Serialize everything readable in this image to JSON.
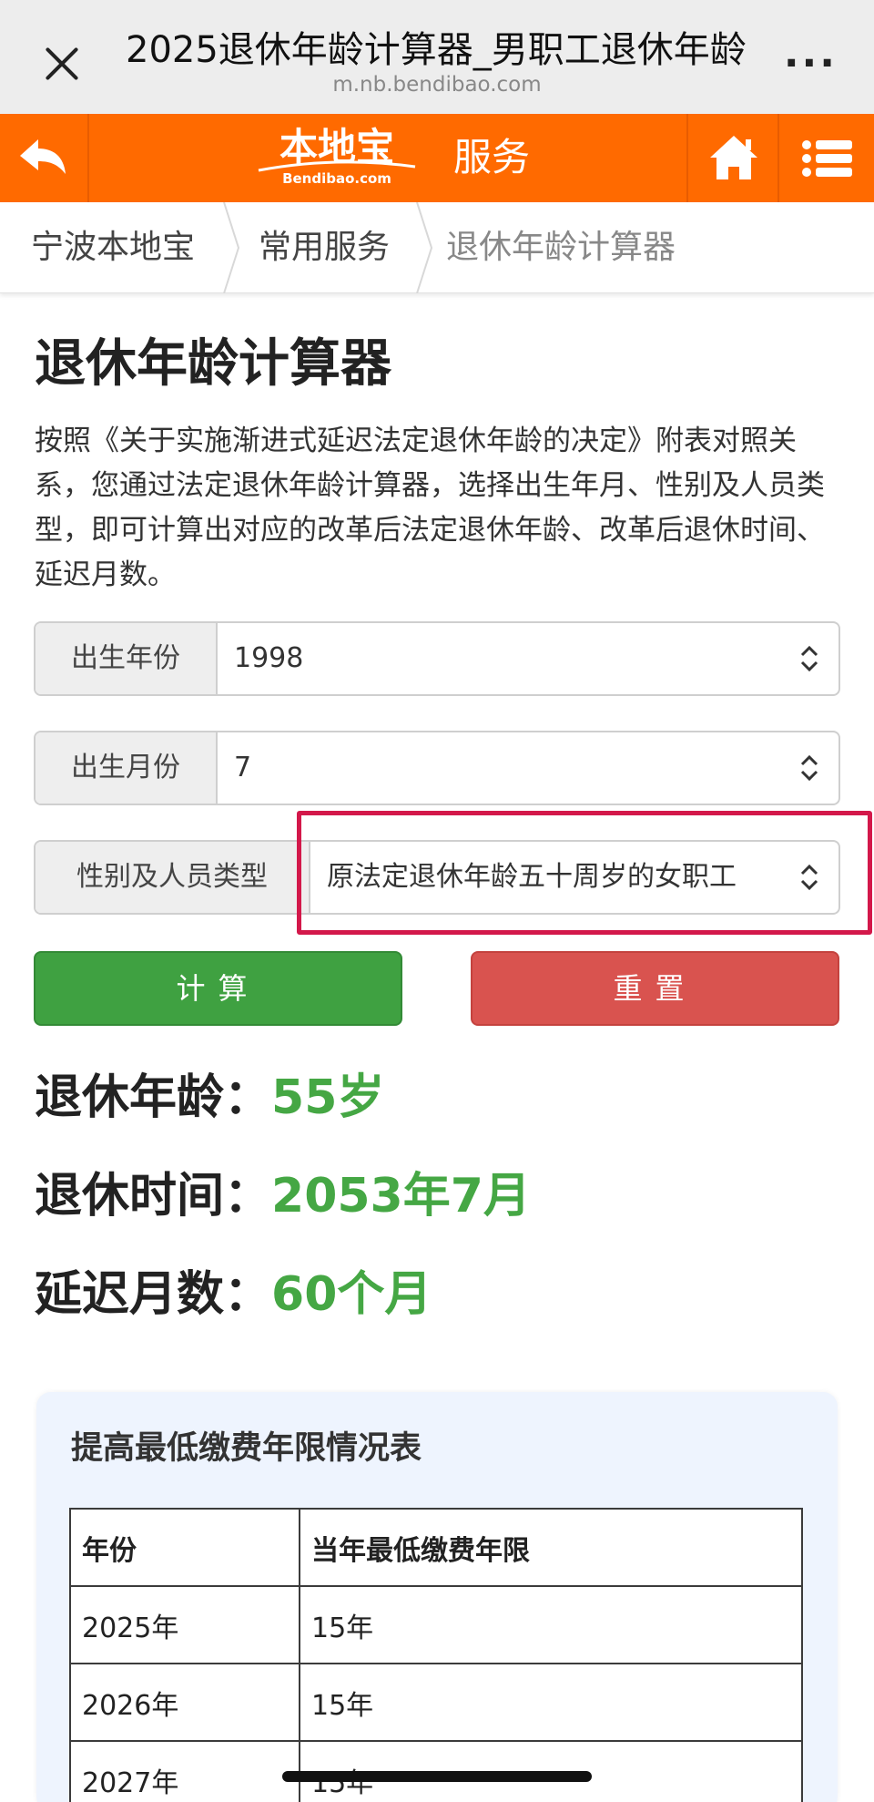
{
  "browser": {
    "title": "2025退休年龄计算器_男职工退休年龄",
    "domain": "m.nb.bendibao.com",
    "more": "···"
  },
  "header": {
    "logo_main": "本地宝",
    "logo_sub": "Bendibao.com",
    "service": "服务",
    "color": "#ff6a00"
  },
  "breadcrumb": [
    "宁波本地宝",
    "常用服务",
    "退休年龄计算器"
  ],
  "page": {
    "title": "退休年龄计算器",
    "intro": "按照《关于实施渐进式延迟法定退休年龄的决定》附表对照关系，您通过法定退休年龄计算器，选择出生年月、性别及人员类型，即可计算出对应的改革后法定退休年龄、改革后退休时间、延迟月数。"
  },
  "form": {
    "birth_year_label": "出生年份",
    "birth_year_value": "1998",
    "birth_month_label": "出生月份",
    "birth_month_value": "7",
    "type_label": "性别及人员类型",
    "type_value": "原法定退休年龄五十周岁的女职工",
    "calc_button": "计算",
    "reset_button": "重置"
  },
  "results": {
    "age_label": "退休年龄：",
    "age_value": "55岁",
    "time_label": "退休时间：",
    "time_value": "2053年7月",
    "delay_label": "延迟月数：",
    "delay_value": "60个月"
  },
  "table": {
    "title": "提高最低缴费年限情况表",
    "headers": [
      "年份",
      "当年最低缴费年限"
    ],
    "rows": [
      [
        "2025年",
        "15年"
      ],
      [
        "2026年",
        "15年"
      ],
      [
        "2027年",
        "15年"
      ]
    ]
  },
  "colors": {
    "accent_green": "#45a744",
    "button_green": "#3fa141",
    "button_red": "#d9534f",
    "highlight": "#d3184a"
  }
}
